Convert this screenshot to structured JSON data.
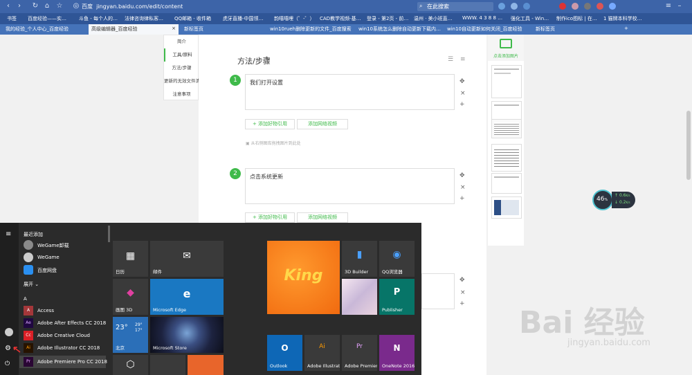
{
  "browser": {
    "site_label": "百度",
    "url": "jingyan.baidu.com/edit/content",
    "search_placeholder": "在此搜索",
    "bookmarks": [
      "书签",
      "百度经验——实…",
      "斗鱼 - 每个人的…",
      "法律咨询律私客…",
      "QQ邮箱 - 收件箱",
      "虎牙直播-中国领…",
      "韵嘻嘻哩（゜-゜）",
      "CAD教学视频-基…",
      "登录 - 第2页 - 前…",
      "温州 · 美小班直…",
      "WWW. 4 3 8 8 …",
      "强化工具 - Win…",
      "制作ico图标 | 在…",
      "1 猫牌本科学校…"
    ],
    "tabs": [
      "我的经验_个人中心_百度经验",
      "高级编辑器_百度经验",
      "新标签页",
      "win10rueh删除更新的文件_百度搜索",
      "win10系统怎么删除自动更新下载内…",
      "win10自动更新如何关闭_百度经验",
      "新标签页"
    ],
    "new_tab_symbol": "+",
    "tab_close": "×"
  },
  "outline": {
    "items": [
      "简介",
      "工具/原料",
      "方法/步骤",
      "更新的无效文件清",
      "注意事项"
    ],
    "active_index": 1
  },
  "editor": {
    "section_title": "方法/步骤",
    "steps": [
      {
        "number": "1",
        "text": "我们打开设置"
      },
      {
        "number": "2",
        "text": "点击系统更新"
      }
    ],
    "add_quote_label": "+ 添加好物引用",
    "add_video_label": "添加网络视频",
    "drag_hint": "从右侧图库拖拽图片到此处",
    "ctrl_move": "✥",
    "ctrl_delete": "×",
    "ctrl_add": "+"
  },
  "right_panel": {
    "add_image_label": "点击添加图片"
  },
  "gauge": {
    "percent": "46",
    "percent_unit": "%",
    "upload": "0.6",
    "download": "0.2",
    "unit": "K/s"
  },
  "start_menu": {
    "recent_header": "最近添加",
    "recent": [
      {
        "name": "WeGame卸载",
        "icon": "wegame-uninstall-icon"
      },
      {
        "name": "WeGame",
        "icon": "wegame-icon"
      },
      {
        "name": "百度网盘",
        "icon": "baidu-netdisk-icon"
      }
    ],
    "expand_label": "展开 ⌄",
    "letter": "A",
    "apps": [
      {
        "name": "Access",
        "badge": "A",
        "color": "#a4373a"
      },
      {
        "name": "Adobe After Effects CC 2018",
        "badge": "Ae",
        "color": "#1f0740"
      },
      {
        "name": "Adobe Creative Cloud",
        "badge": "Cc",
        "color": "#da1f26"
      },
      {
        "name": "Adobe Illustrator CC 2018",
        "badge": "Ai",
        "color": "#261300"
      },
      {
        "name": "Adobe Premiere Pro CC 2018",
        "badge": "Pr",
        "color": "#2a0634"
      }
    ],
    "tiles": [
      {
        "name": "日历",
        "color": "#3a3a3a"
      },
      {
        "name": "邮件",
        "color": "#3a3a3a"
      },
      {
        "name": "画图 3D",
        "color": "#3a3a3a"
      },
      {
        "name": "Microsoft Edge",
        "color": "#1a78c2"
      },
      {
        "name": "北京",
        "color": "#2b6fb8"
      },
      {
        "name": "Microsoft Store",
        "color": "#222"
      },
      {
        "name": "3D Builder",
        "color": "#3a3a3a"
      },
      {
        "name": "QQ浏览器",
        "color": "#3a3a3a"
      },
      {
        "name": "Publisher",
        "color": "#077568"
      },
      {
        "name": "Outlook",
        "color": "#0e67b6"
      },
      {
        "name": "Adobe Illustrator CC...",
        "color": "#3a3a3a"
      },
      {
        "name": "Adobe Premiere Pro...",
        "color": "#3a3a3a"
      },
      {
        "name": "OneNote 2016",
        "color": "#7a2a8c"
      }
    ],
    "weather_temp": "23°",
    "weather_hi": "29°",
    "weather_lo": "17°",
    "king_text": "King"
  },
  "watermark": {
    "text": "Bai 经验",
    "url": "jingyan.baidu.com"
  }
}
